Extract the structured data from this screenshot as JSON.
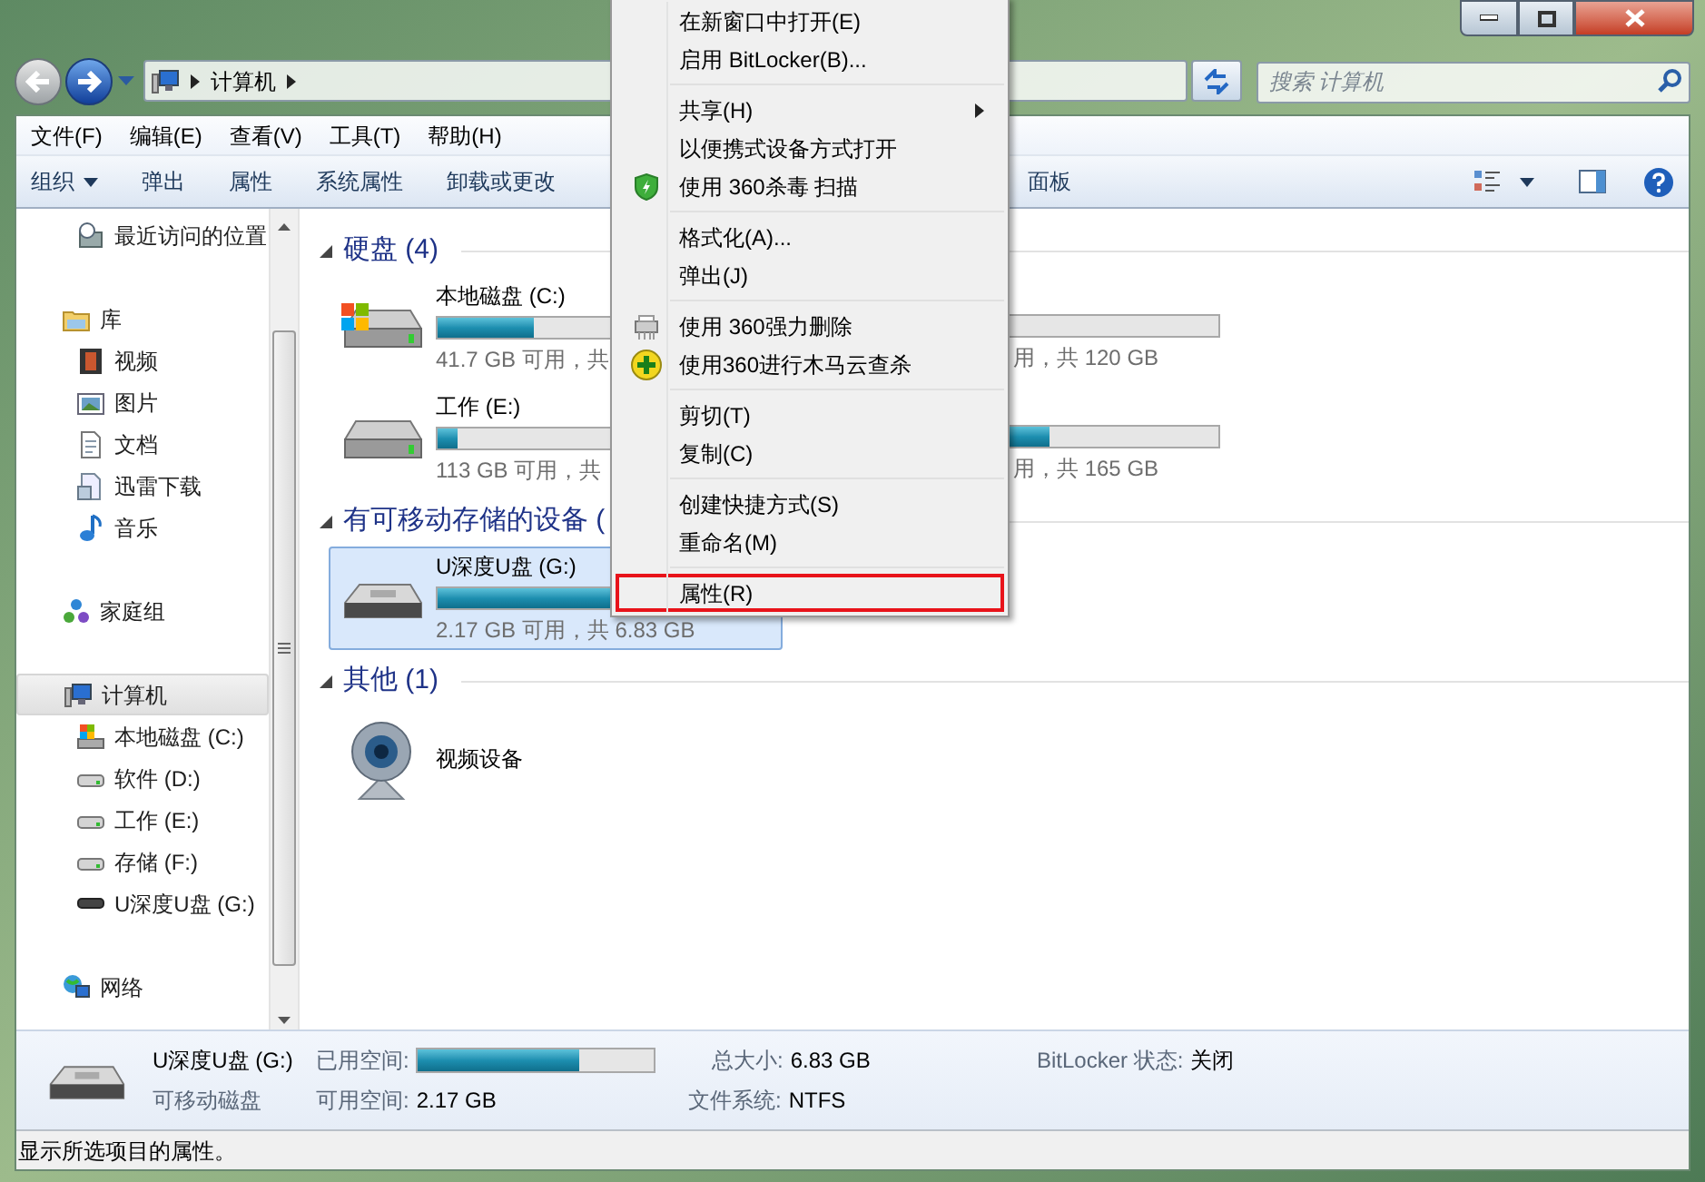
{
  "window": {
    "address": [
      "计算机"
    ],
    "search": {
      "placeholder": "搜索 计算机"
    }
  },
  "menu_bar": [
    "文件(F)",
    "编辑(E)",
    "查看(V)",
    "工具(T)",
    "帮助(H)"
  ],
  "toolbar": {
    "items": [
      {
        "label": "组织",
        "kind": "dropdown"
      },
      {
        "label": "弹出",
        "kind": "plain"
      },
      {
        "label": "属性",
        "kind": "plain"
      },
      {
        "label": "系统属性",
        "kind": "plain"
      },
      {
        "label": "卸载或更改",
        "kind": "plain"
      }
    ],
    "right_fragment": "面板"
  },
  "sidebar": [
    {
      "label": "最近访问的位置",
      "kind": "recent",
      "selected": false
    },
    {
      "label": "库",
      "kind": "library",
      "selected": false,
      "children": [
        {
          "label": "视频",
          "kind": "video",
          "selected": false
        },
        {
          "label": "图片",
          "kind": "picture",
          "selected": false
        },
        {
          "label": "文档",
          "kind": "document",
          "selected": false
        },
        {
          "label": "迅雷下载",
          "kind": "download",
          "selected": false
        },
        {
          "label": "音乐",
          "kind": "music",
          "selected": false
        }
      ]
    },
    {
      "label": "家庭组",
      "kind": "homegroup",
      "selected": false
    },
    {
      "label": "计算机",
      "kind": "computer",
      "selected": true,
      "children": [
        {
          "label": "本地磁盘 (C:)",
          "kind": "windrive",
          "selected": false
        },
        {
          "label": "软件 (D:)",
          "kind": "drive",
          "selected": false
        },
        {
          "label": "工作 (E:)",
          "kind": "drive",
          "selected": false
        },
        {
          "label": "存储 (F:)",
          "kind": "drive",
          "selected": false
        },
        {
          "label": "U深度U盘 (G:)",
          "kind": "usb",
          "selected": false
        }
      ]
    },
    {
      "label": "网络",
      "kind": "network",
      "selected": false
    }
  ],
  "groups": [
    {
      "title": "硬盘 (4)",
      "rows": [
        {
          "left": {
            "name": "本地磁盘 (C:)",
            "usage": "41.7 GB 可用，共",
            "level": 0.3,
            "kind": "windrive",
            "selected": false
          },
          "right": {
            "usage": "用，共 120 GB"
          }
        },
        {
          "left": {
            "name": "工作 (E:)",
            "usage": "113 GB 可用，共",
            "level": 0.06,
            "kind": "drive",
            "selected": false
          },
          "right": {
            "usage": "用，共 165 GB",
            "level": 0.48
          }
        }
      ]
    },
    {
      "title": "有可移动存储的设备 (",
      "rows": [
        {
          "left": {
            "name": "U深度U盘 (G:)",
            "usage": "2.17 GB 可用，共 6.83 GB",
            "level": 0.68,
            "kind": "usb",
            "selected": true
          }
        }
      ]
    },
    {
      "title": "其他 (1)",
      "rows": [
        {
          "left": {
            "name": "视频设备",
            "kind": "webcam",
            "selected": false
          }
        }
      ]
    }
  ],
  "context_menu": [
    {
      "kind": "plain",
      "label": "在新窗口中打开(E)",
      "selected": false
    },
    {
      "kind": "plain",
      "label": "启用 BitLocker(B)...",
      "selected": false
    },
    {
      "kind": "separator"
    },
    {
      "kind": "submenu",
      "label": "共享(H)",
      "selected": false
    },
    {
      "kind": "plain",
      "label": "以便携式设备方式打开",
      "selected": false
    },
    {
      "kind": "shield",
      "label": "使用 360杀毒 扫描",
      "selected": false
    },
    {
      "kind": "separator"
    },
    {
      "kind": "plain",
      "label": "格式化(A)...",
      "selected": false
    },
    {
      "kind": "plain",
      "label": "弹出(J)",
      "selected": false
    },
    {
      "kind": "separator"
    },
    {
      "kind": "shredder",
      "label": "使用 360强力删除",
      "selected": false
    },
    {
      "kind": "plus",
      "label": "使用360进行木马云查杀",
      "selected": false
    },
    {
      "kind": "separator"
    },
    {
      "kind": "plain",
      "label": "剪切(T)",
      "selected": false
    },
    {
      "kind": "plain",
      "label": "复制(C)",
      "selected": false
    },
    {
      "kind": "separator"
    },
    {
      "kind": "plain",
      "label": "创建快捷方式(S)",
      "selected": false
    },
    {
      "kind": "plain",
      "label": "重命名(M)",
      "selected": false
    },
    {
      "kind": "separator"
    },
    {
      "kind": "plain",
      "label": "属性(R)",
      "selected": true
    }
  ],
  "details": {
    "name": "U深度U盘 (G:)",
    "type": "可移动磁盘",
    "used": {
      "label": "已用空间:",
      "level": 0.68
    },
    "free_label": "可用空间:",
    "free_value": "2.17 GB",
    "total_label": "总大小:",
    "total_value": "6.83 GB",
    "fs_label": "文件系统:",
    "fs_value": "NTFS",
    "bitlocker_label": "BitLocker 状态:",
    "bitlocker_value": "关闭"
  },
  "status_bar": "显示所选项目的属性。"
}
